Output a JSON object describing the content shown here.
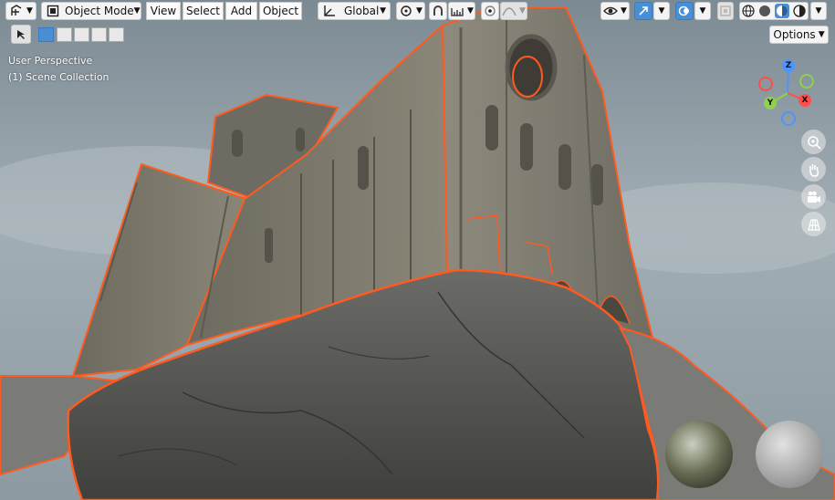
{
  "header": {
    "mode_label": "Object Mode",
    "menus": [
      "View",
      "Select",
      "Add",
      "Object"
    ],
    "transform_orientation": "Global",
    "options_label": "Options"
  },
  "overlay": {
    "view_name": "User Perspective",
    "collection": "(1) Scene Collection"
  },
  "gizmo": {
    "axes": [
      "Z",
      "X",
      "Y"
    ]
  },
  "icons": {
    "editor_type": "transform-gizmo-icon",
    "mode": "object-cube-icon",
    "orientation": "axis-orientation-icon",
    "pivot": "pivot-point-icon",
    "snap": "magnet-icon",
    "snap_target": "snap-increment-icon",
    "proportional": "proportional-edit-icon",
    "falloff": "falloff-curve-icon",
    "visibility": "eye-icon",
    "gizmo": "gizmo-toggle-icon",
    "overlays": "overlay-icon",
    "xray": "xray-icon",
    "shading_wire": "wireframe-sphere-icon",
    "shading_solid": "solid-sphere-icon",
    "shading_material": "material-sphere-icon",
    "shading_render": "rendered-sphere-icon",
    "zoom": "zoom-icon",
    "pan": "hand-icon",
    "camera": "camera-icon",
    "ortho": "grid-icon"
  },
  "colors": {
    "selection_outline": "#ff5a1f",
    "axis_x": "#ff4d4d",
    "axis_y": "#8fd14f",
    "axis_z": "#4d94ff",
    "active_button": "#4a8fd6"
  }
}
